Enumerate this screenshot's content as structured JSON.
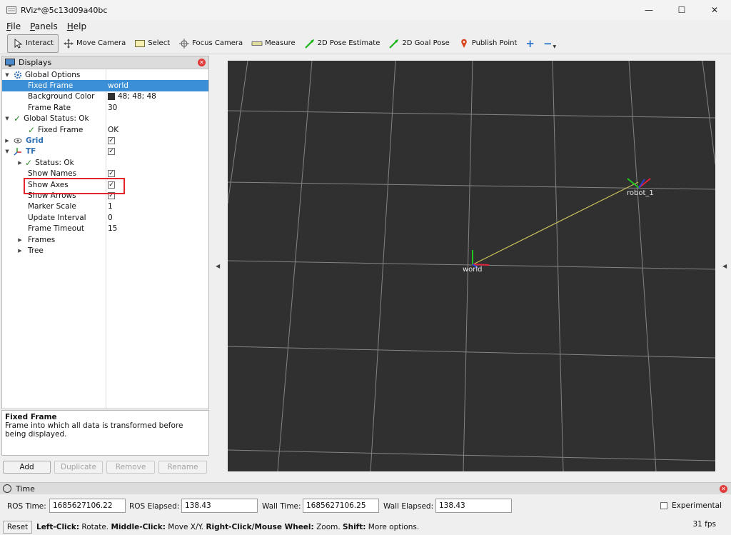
{
  "window": {
    "title": "RViz*@5c13d09a40bc",
    "minimize": "—",
    "maximize": "☐",
    "close": "✕"
  },
  "menu": {
    "items": [
      {
        "underline": "F",
        "rest": "ile"
      },
      {
        "underline": "P",
        "rest": "anels"
      },
      {
        "underline": "H",
        "rest": "elp"
      }
    ]
  },
  "toolbar": {
    "tools": [
      {
        "label": "Interact",
        "icon": "cursor-icon",
        "active": true
      },
      {
        "label": "Move Camera",
        "icon": "move-camera-icon"
      },
      {
        "label": "Select",
        "icon": "select-icon"
      },
      {
        "label": "Focus Camera",
        "icon": "focus-icon"
      },
      {
        "label": "Measure",
        "icon": "ruler-icon"
      },
      {
        "label": "2D Pose Estimate",
        "icon": "green-arrow-icon"
      },
      {
        "label": "2D Goal Pose",
        "icon": "green-arrow-icon"
      },
      {
        "label": "Publish Point",
        "icon": "pin-icon"
      }
    ],
    "add": "+",
    "remove": "−"
  },
  "displays": {
    "title": "Displays",
    "rows": [
      {
        "name": "Global Options",
        "value": ""
      },
      {
        "name": "Fixed Frame",
        "value": "world"
      },
      {
        "name": "Background Color",
        "value": "48; 48; 48"
      },
      {
        "name": "Frame Rate",
        "value": "30"
      },
      {
        "name": "Global Status: Ok",
        "value": ""
      },
      {
        "name": "Fixed Frame",
        "value": "OK"
      },
      {
        "name": "Grid",
        "value": "✓"
      },
      {
        "name": "TF",
        "value": "✓"
      },
      {
        "name": "Status: Ok",
        "value": ""
      },
      {
        "name": "Show Names",
        "value": "✓"
      },
      {
        "name": "Show Axes",
        "value": "✓"
      },
      {
        "name": "Show Arrows",
        "value": "✓"
      },
      {
        "name": "Marker Scale",
        "value": "1"
      },
      {
        "name": "Update Interval",
        "value": "0"
      },
      {
        "name": "Frame Timeout",
        "value": "15"
      },
      {
        "name": "Frames",
        "value": ""
      },
      {
        "name": "Tree",
        "value": ""
      }
    ]
  },
  "description": {
    "title": "Fixed Frame",
    "text": "Frame into which all data is transformed before being displayed."
  },
  "panel_buttons": {
    "add": "Add",
    "duplicate": "Duplicate",
    "remove": "Remove",
    "rename": "Rename"
  },
  "viewport": {
    "background": "#303030",
    "frames": {
      "world": "world",
      "robot": "robot_1"
    }
  },
  "time": {
    "title": "Time",
    "ros_time_label": "ROS Time:",
    "ros_time": "1685627106.22",
    "ros_elapsed_label": "ROS Elapsed:",
    "ros_elapsed": "138.43",
    "wall_time_label": "Wall Time:",
    "wall_time": "1685627106.25",
    "wall_elapsed_label": "Wall Elapsed:",
    "wall_elapsed": "138.43",
    "experimental": "Experimental"
  },
  "status": {
    "reset": "Reset",
    "hint_parts": [
      {
        "b": "Left-Click:",
        "t": " Rotate. "
      },
      {
        "b": "Middle-Click:",
        "t": " Move X/Y. "
      },
      {
        "b": "Right-Click/Mouse Wheel:",
        "t": " Zoom. "
      },
      {
        "b": "Shift:",
        "t": " More options."
      }
    ],
    "fps": "31 fps"
  }
}
